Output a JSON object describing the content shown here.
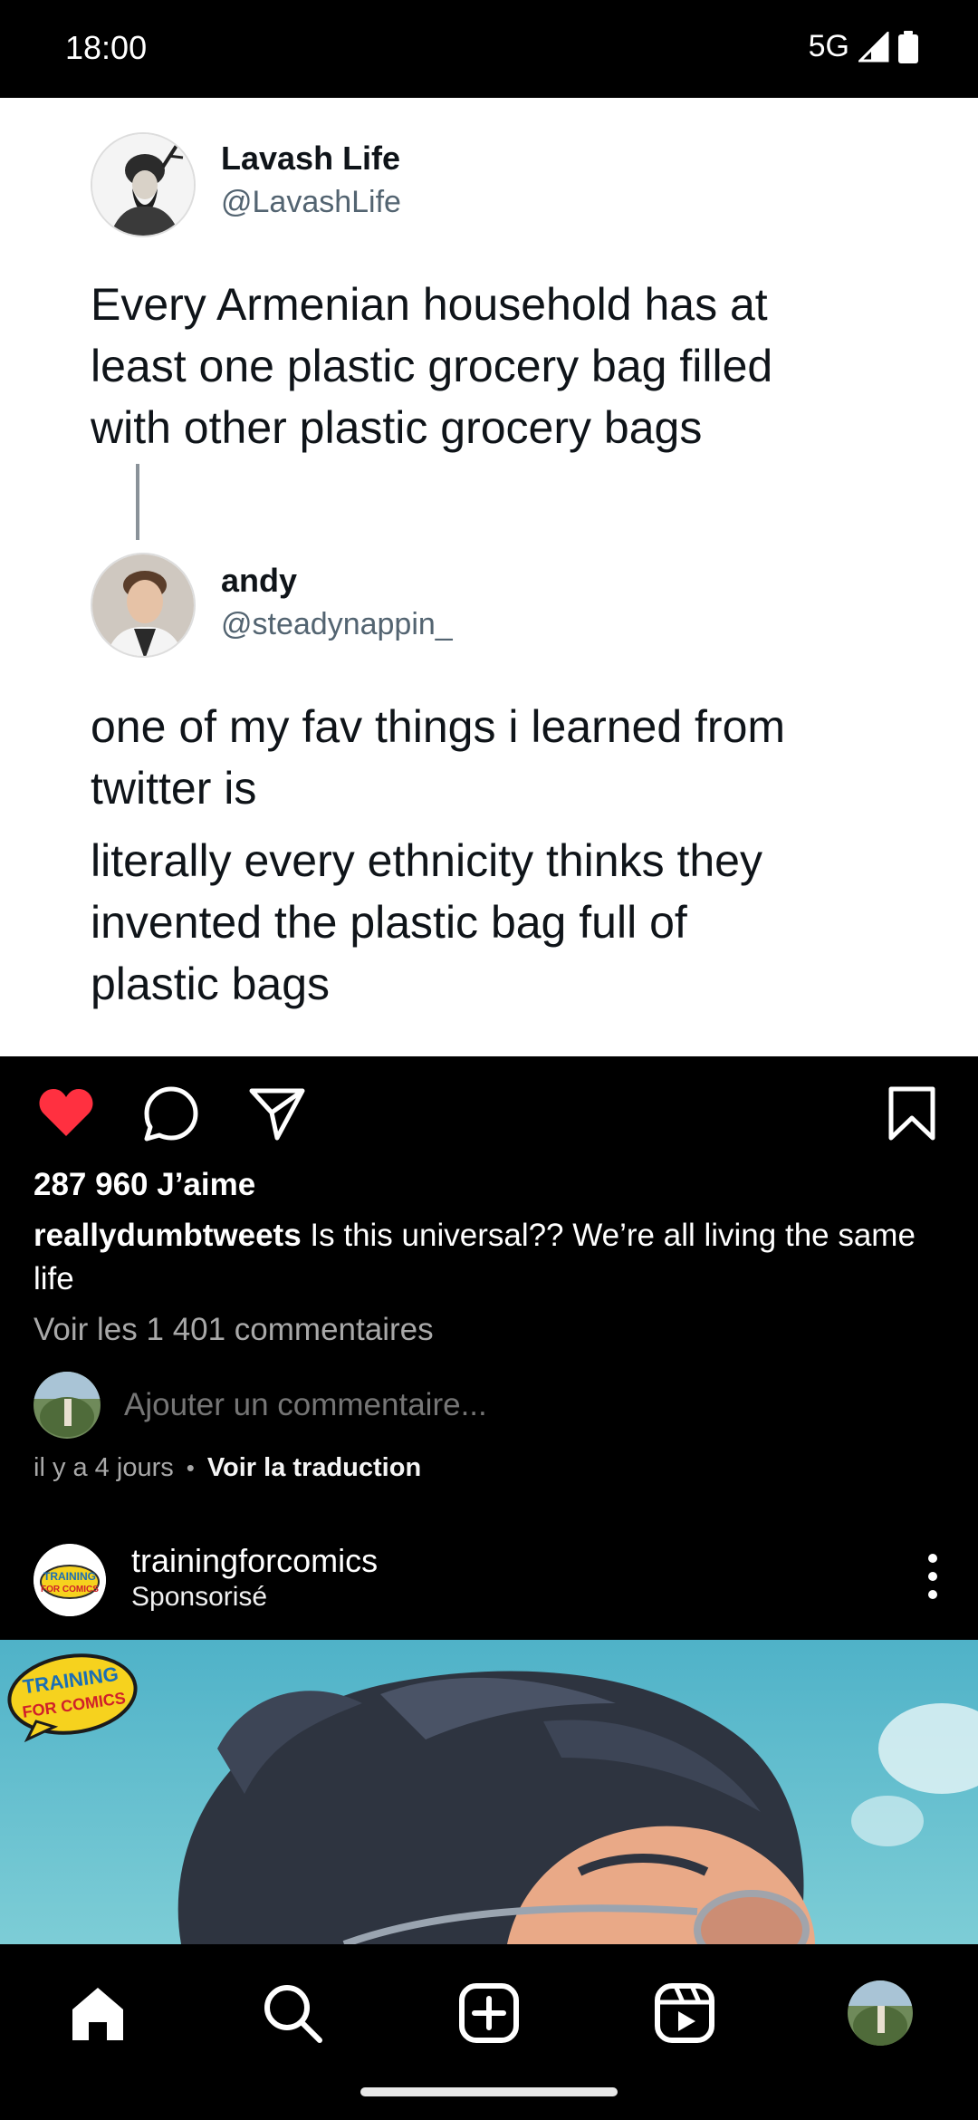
{
  "status_bar": {
    "time": "18:00",
    "network": "5G"
  },
  "tweet": {
    "original": {
      "name": "Lavash Life",
      "handle": "@LavashLife",
      "text_lines": [
        "Every Armenian household has at",
        "least one plastic grocery bag filled",
        "with other plastic grocery bags"
      ]
    },
    "reply": {
      "name": "andy",
      "handle": "@steadynappin_",
      "text_lines": [
        "one of my fav things i learned from",
        "twitter is",
        "literally every ethnicity thinks they",
        "invented the plastic bag full of",
        "plastic bags"
      ]
    }
  },
  "post": {
    "liked": true,
    "like_color": "#ff3040",
    "likes": "287 960 J’aime",
    "caption_user": "reallydumbtweets",
    "caption_text": "Is this universal?? We’re all living the same life",
    "view_comments": "Voir les 1 401 commentaires",
    "comment_placeholder": "Ajouter un commentaire...",
    "time_ago": "il y a 4 jours",
    "separator": "•",
    "translate_link": "Voir la traduction"
  },
  "sponsored": {
    "account": "trainingforcomics",
    "label": "Sponsorisé",
    "logo_line1": "TRAINING",
    "logo_line2": "FOR COMICS"
  },
  "icons": {
    "actions": [
      "heart-icon",
      "comment-icon",
      "share-icon",
      "bookmark-icon"
    ],
    "nav": [
      "home-icon",
      "search-icon",
      "create-icon",
      "reels-icon",
      "profile-avatar"
    ]
  }
}
